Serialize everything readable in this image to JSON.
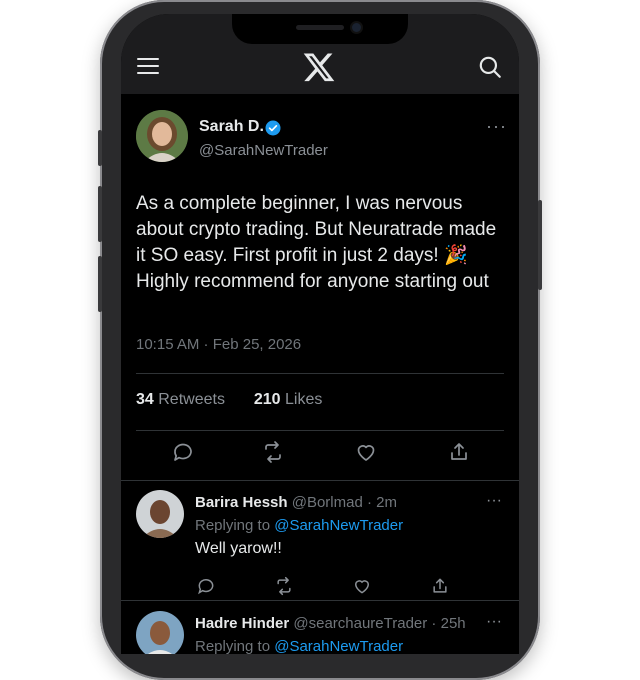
{
  "header": {
    "menu_icon": "hamburger-menu-icon",
    "logo_icon": "x-logo-icon",
    "search_icon": "search-icon"
  },
  "tweet": {
    "author_name": "Sarah D.",
    "handle": "@SarahNewTrader",
    "verified": true,
    "text": "As a complete beginner, I was nervous about crypto trading. But Neuratrade made it SO easy. First profit in just 2 days! 🎉 Highly recommend for anyone starting out",
    "timestamp": "10:15 AM · Feb 25, 2026",
    "retweets_count": "34",
    "retweets_label": "Retweets",
    "likes_count": "210",
    "likes_label": "Likes",
    "more_label": "···",
    "actions": [
      "reply-icon",
      "retweet-icon",
      "like-icon",
      "share-icon"
    ]
  },
  "replies": [
    {
      "name": "Barira Hessh",
      "meta": "@Borlmad · 2m",
      "replying_prefix": "Replying to",
      "replying_to": "@SarahNewTrader",
      "text": "Well yarow!!",
      "more_label": "···"
    },
    {
      "name": "Hadre Hinder",
      "meta": "@searchaureTrader · 25h",
      "replying_prefix": "Replying to",
      "replying_to": "@SarahNewTrader",
      "text": "",
      "more_label": "···"
    }
  ],
  "colors": {
    "accent": "#1d9bf0",
    "background": "#000000",
    "header_bg": "#1c1c1e",
    "muted_text": "#71767b",
    "divider": "#2f3336"
  }
}
